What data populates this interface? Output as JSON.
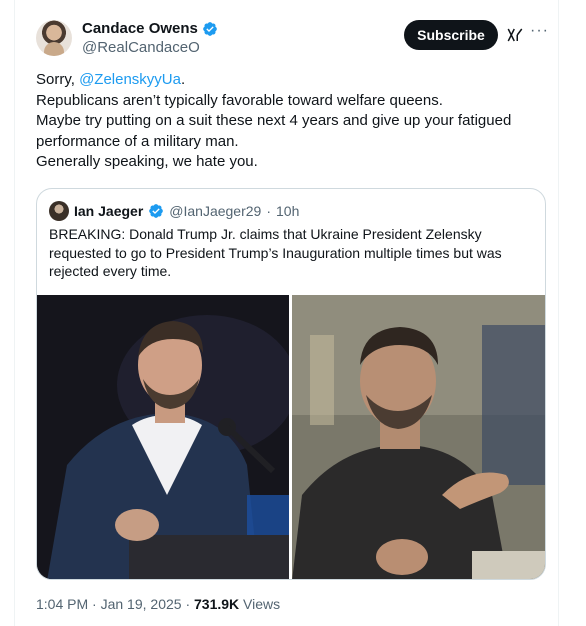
{
  "tweet": {
    "display_name": "Candace Owens",
    "handle": "@RealCandaceO",
    "subscribe_label": "Subscribe",
    "more_label": "···",
    "text": {
      "line1_prefix": "Sorry, ",
      "mention": "@ZelenskyyUa",
      "line1_suffix": ".",
      "line2": "Republicans aren’t typically favorable toward welfare queens.",
      "line3": "Maybe try putting on a suit these next 4 years and give up your fatigued",
      "line4": "performance of a military man.",
      "line5": "Generally speaking, we hate you."
    },
    "meta": {
      "time": "1:04 PM",
      "sep1": " · ",
      "date": "Jan 19, 2025",
      "sep2": " · ",
      "views_count": "731.9K",
      "views_label": " Views"
    }
  },
  "quote": {
    "display_name": "Ian Jaeger",
    "handle": "@IanJaeger29",
    "separator": "·",
    "age": "10h",
    "text": {
      "line1": "BREAKING: Donald Trump Jr. claims that Ukraine President Zelensky",
      "line2": "requested to go to President Trump’s Inauguration multiple times but was",
      "line3": "rejected every time."
    }
  },
  "colors": {
    "accent": "#1d9bf0",
    "text": "#0f1419",
    "secondary": "#536471",
    "border": "#cfd9de"
  },
  "icons": {
    "verified": "verified-badge-icon",
    "grok": "grok-icon",
    "more": "more-icon"
  }
}
